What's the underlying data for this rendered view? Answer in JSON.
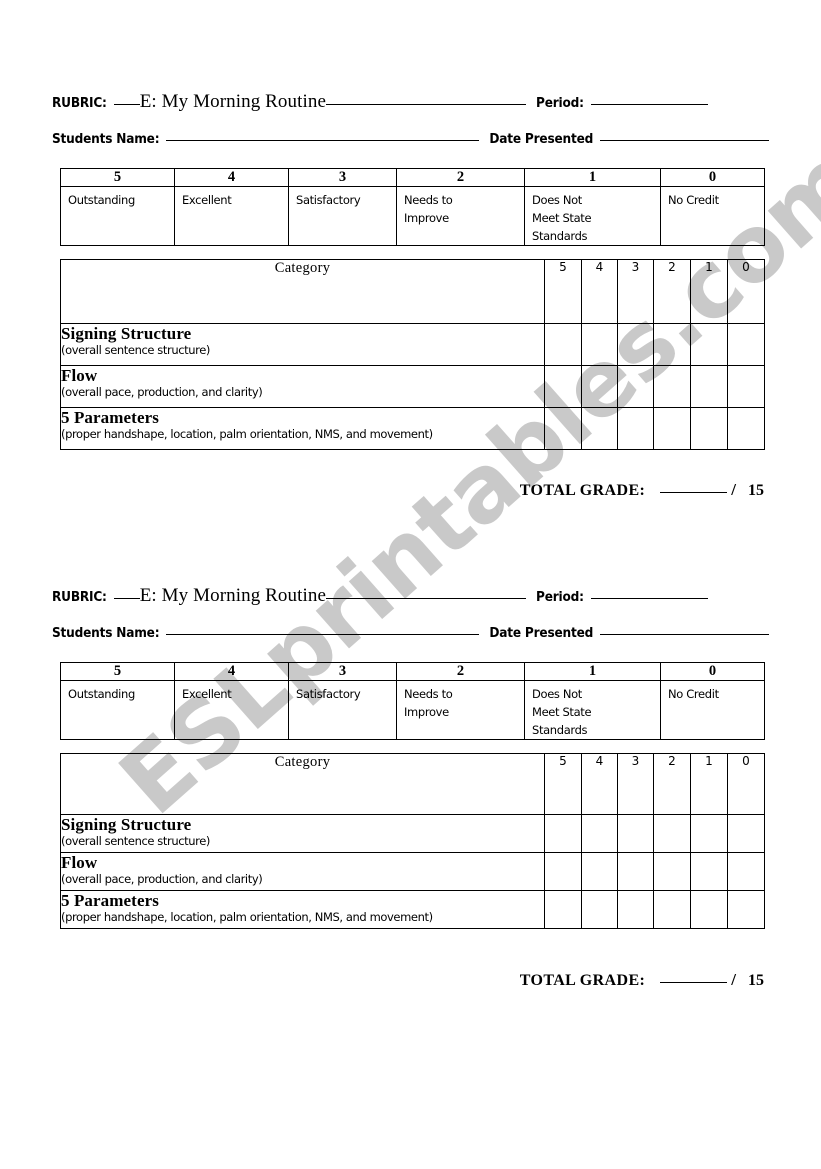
{
  "document": {
    "watermark": "ESLprintables.com",
    "watermark_color": "#c9c9c9"
  },
  "header": {
    "rubric_label": "RUBRIC:",
    "title": "E: My Morning Routine",
    "period_label": "Period:",
    "students_name_label": "Students Name:",
    "date_presented_label": "Date Presented"
  },
  "scale_table": {
    "scores": [
      "5",
      "4",
      "3",
      "2",
      "1",
      "0"
    ],
    "descriptions": [
      [
        "Outstanding"
      ],
      [
        "Excellent"
      ],
      [
        "Satisfactory"
      ],
      [
        "Needs to",
        "Improve"
      ],
      [
        "Does Not",
        "Meet State",
        "Standards"
      ],
      [
        "No Credit"
      ]
    ]
  },
  "category_table": {
    "category_header": "Category",
    "score_headers": [
      "5",
      "4",
      "3",
      "2",
      "1",
      "0"
    ],
    "rows": [
      {
        "name": "Signing Structure",
        "detail": "(overall sentence structure)"
      },
      {
        "name": "Flow",
        "detail": "(overall pace, production, and clarity)"
      },
      {
        "name": "5 Parameters",
        "detail": "(proper handshape, location, palm orientation, NMS, and movement)"
      }
    ]
  },
  "total": {
    "label": "TOTAL GRADE:",
    "separator": "/",
    "max": "15"
  }
}
